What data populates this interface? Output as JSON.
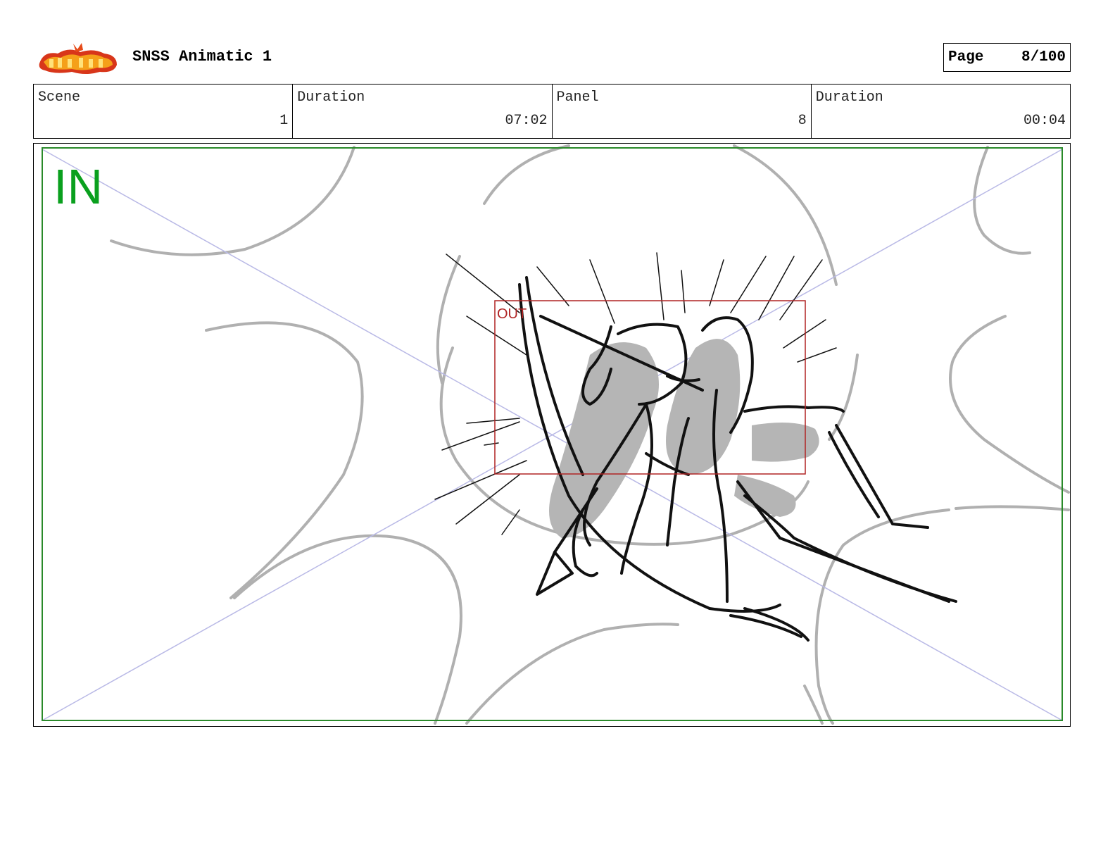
{
  "header": {
    "logo_icon": "sir-fans-a-lot-logo-icon",
    "title": "SNSS Animatic 1",
    "page_label": "Page",
    "page_value": "8/100"
  },
  "info": [
    {
      "label": "Scene",
      "value": "1"
    },
    {
      "label": "Duration",
      "value": "07:02"
    },
    {
      "label": "Panel",
      "value": "8"
    },
    {
      "label": "Duration",
      "value": "00:04"
    }
  ],
  "panel": {
    "in_label": "IN",
    "out_label": "OUT",
    "colors": {
      "in_frame": "#2a8a2a",
      "out_frame": "#b02424",
      "in_text": "#0aa01e",
      "guide_lines": "#b9b9e6",
      "background_sketch": "#b0b0b0",
      "ink": "#111111",
      "shadow": "#b5b5b5"
    }
  }
}
